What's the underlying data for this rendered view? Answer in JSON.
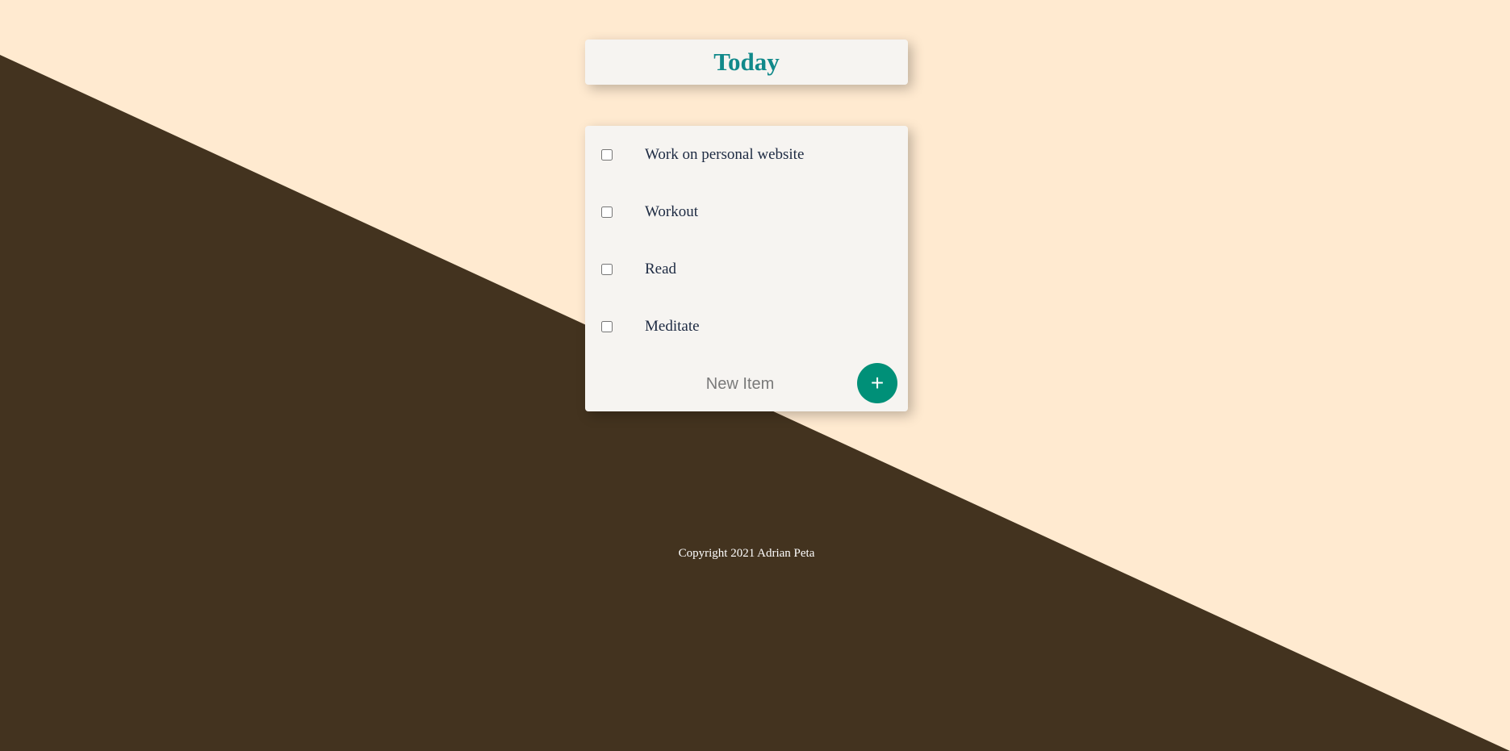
{
  "heading": {
    "title": "Today"
  },
  "items": [
    {
      "label": "Work on personal website",
      "checked": false
    },
    {
      "label": "Workout",
      "checked": false
    },
    {
      "label": "Read",
      "checked": false
    },
    {
      "label": "Meditate",
      "checked": false
    }
  ],
  "form": {
    "placeholder": "New Item",
    "value": "",
    "add_label": "+"
  },
  "footer": {
    "copyright": "Copyright 2021 Adrian Peta"
  },
  "colors": {
    "background": "#FFEAD0",
    "dark_background": "#43331F",
    "card": "#F6F4F1",
    "accent": "#11898A",
    "button": "#009078",
    "item_text": "#1D2A42"
  }
}
